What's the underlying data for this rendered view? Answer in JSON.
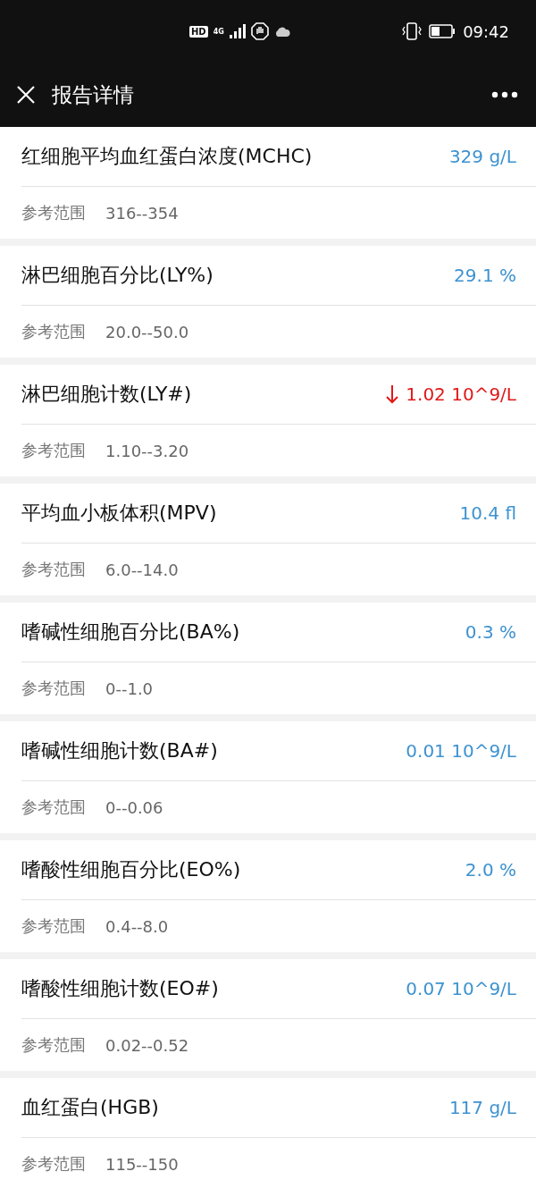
{
  "status_bar": {
    "hd": "HD",
    "network": "4G",
    "time": "09:42"
  },
  "header": {
    "title": "报告详情"
  },
  "results": [
    {
      "name": "红细胞平均血红蛋白浓度(MCHC)",
      "value": "329 g/L",
      "low": false,
      "range_label": "参考范围",
      "range": "316--354"
    },
    {
      "name": "淋巴细胞百分比(LY%)",
      "value": "29.1 %",
      "low": false,
      "range_label": "参考范围",
      "range": "20.0--50.0"
    },
    {
      "name": "淋巴细胞计数(LY#)",
      "value": "1.02 10^9/L",
      "low": true,
      "range_label": "参考范围",
      "range": "1.10--3.20"
    },
    {
      "name": "平均血小板体积(MPV)",
      "value": "10.4 fl",
      "low": false,
      "range_label": "参考范围",
      "range": "6.0--14.0"
    },
    {
      "name": "嗜碱性细胞百分比(BA%)",
      "value": "0.3 %",
      "low": false,
      "range_label": "参考范围",
      "range": "0--1.0"
    },
    {
      "name": "嗜碱性细胞计数(BA#)",
      "value": "0.01 10^9/L",
      "low": false,
      "range_label": "参考范围",
      "range": "0--0.06"
    },
    {
      "name": "嗜酸性细胞百分比(EO%)",
      "value": "2.0 %",
      "low": false,
      "range_label": "参考范围",
      "range": "0.4--8.0"
    },
    {
      "name": "嗜酸性细胞计数(EO#)",
      "value": "0.07 10^9/L",
      "low": false,
      "range_label": "参考范围",
      "range": "0.02--0.52"
    },
    {
      "name": "血红蛋白(HGB)",
      "value": "117 g/L",
      "low": false,
      "range_label": "参考范围",
      "range": "115--150"
    }
  ]
}
